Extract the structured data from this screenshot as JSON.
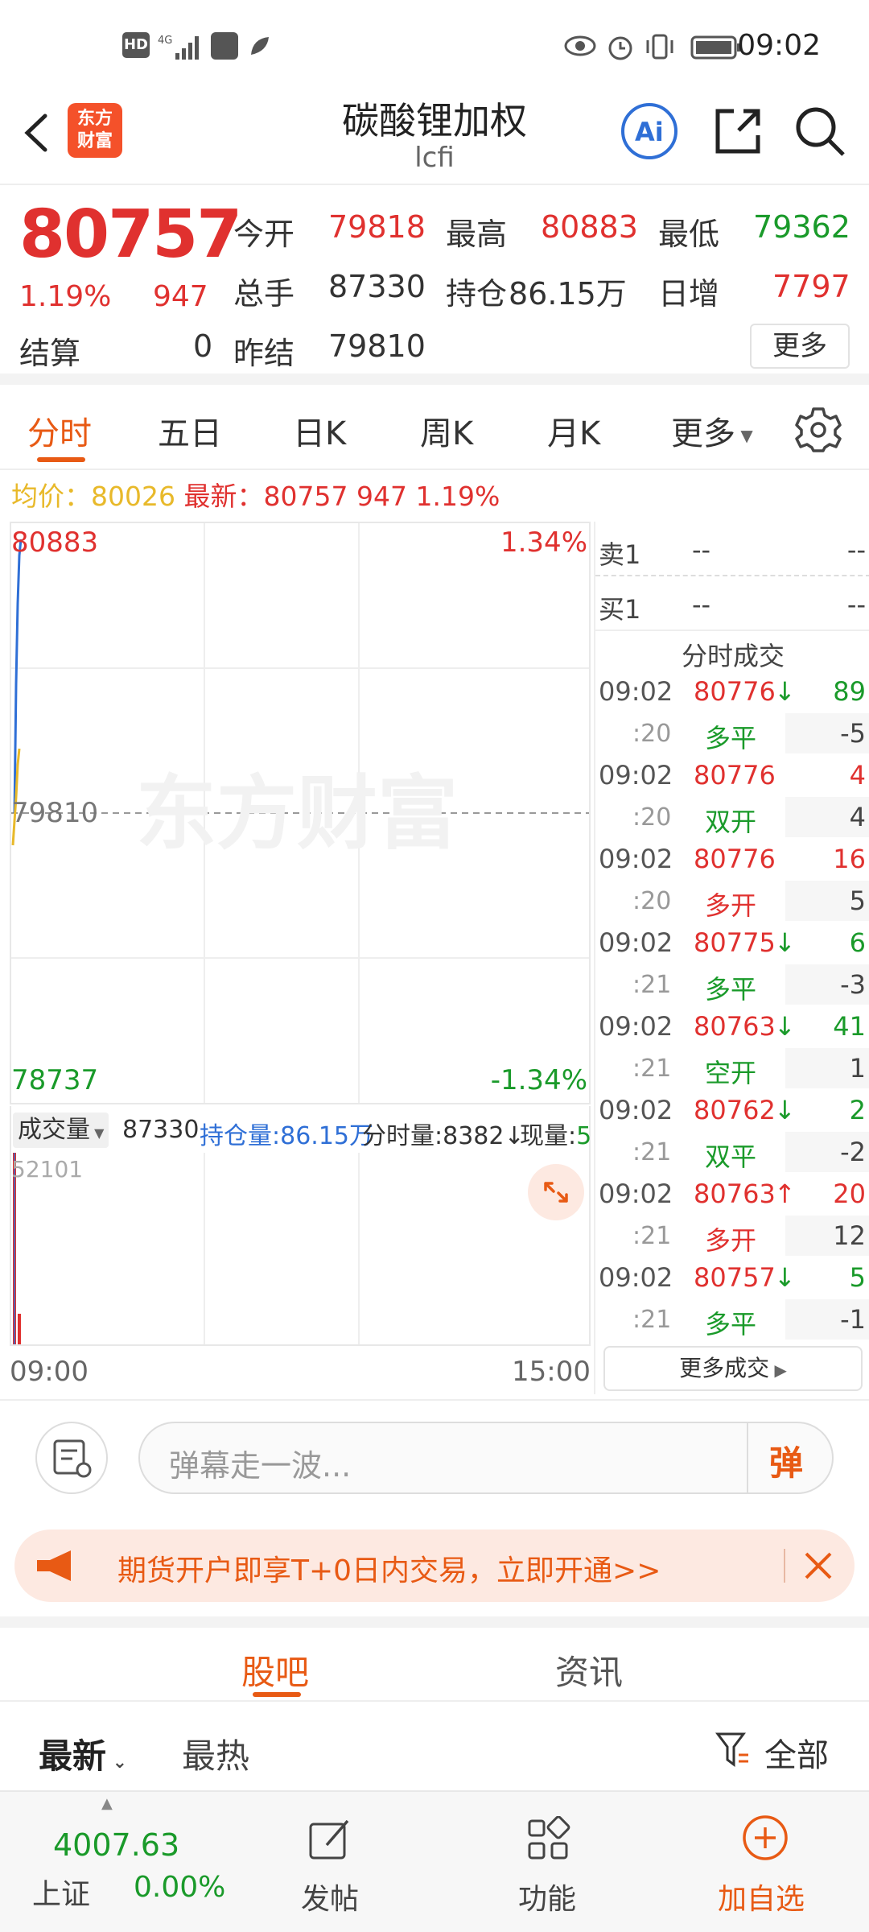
{
  "status_bar": {
    "time": "09:02",
    "left_icons": [
      "hd-icon",
      "signal-4g-icon",
      "bag-icon",
      "leaf-icon"
    ],
    "right_icons": [
      "eye-icon",
      "alarm-icon",
      "vibrate-icon",
      "battery-icon"
    ]
  },
  "header": {
    "title": "碳酸锂加权",
    "subtitle": "lcfi",
    "logo_text_line1": "东方",
    "logo_text_line2": "财富"
  },
  "quote": {
    "last_price": "80757",
    "change_pct": "1.19%",
    "change": "947",
    "open_label": "今开",
    "open": "79818",
    "high_label": "最高",
    "high": "80883",
    "low_label": "最低",
    "low": "79362",
    "volume_label": "总手",
    "volume": "87330",
    "oi_label": "持仓",
    "oi": "86.15万",
    "daily_inc_label": "日增",
    "daily_inc": "7797",
    "settle_label": "结算",
    "settle": "0",
    "prev_settle_label": "昨结",
    "prev_settle": "79810",
    "more_label": "更多"
  },
  "tabs": [
    {
      "label": "分时"
    },
    {
      "label": "五日"
    },
    {
      "label": "日K"
    },
    {
      "label": "周K"
    },
    {
      "label": "月K"
    },
    {
      "label": "更多"
    }
  ],
  "info_line": {
    "avg_label": "均价：",
    "avg": "80026",
    "latest_label": "最新：",
    "latest": "80757",
    "change": "947",
    "pct": "1.19%"
  },
  "chart": {
    "high_price": "80883",
    "high_pct": "1.34%",
    "mid_price": "79810",
    "low_price": "78737",
    "low_pct": "-1.34%",
    "watermark": "东方财富",
    "time_start": "09:00",
    "time_end": "15:00",
    "vol_max": "52101",
    "colors": {
      "price_line": "#2f6fd6",
      "avg_line": "#e8b92a",
      "volume": "#e0312f"
    }
  },
  "chart_data": {
    "type": "line",
    "x": [
      "09:00",
      "09:01",
      "09:02"
    ],
    "series": [],
    "ylim": [
      78737,
      80883
    ]
  },
  "volbar": {
    "dropdown_label": "成交量",
    "volume": "87330",
    "oi_label": "持仓量:86.15万",
    "tick_label": "分时量:8382",
    "arrow": "↓",
    "now_label": "现量:",
    "now": "5"
  },
  "orderbook": {
    "sell1_label": "卖1",
    "sell1_price": "--",
    "sell1_vol": "--",
    "buy1_label": "买1",
    "buy1_price": "--",
    "buy1_vol": "--",
    "trades_title": "分时成交",
    "trades": [
      {
        "time": "09:02",
        "price": "80776",
        "arrow": "↓",
        "vol": "89",
        "sub_time": ":20",
        "type": "多平",
        "type_vol": "-5"
      },
      {
        "time": "09:02",
        "price": "80776",
        "arrow": "",
        "vol": "4",
        "sub_time": ":20",
        "type": "双开",
        "type_vol": "4"
      },
      {
        "time": "09:02",
        "price": "80776",
        "arrow": "",
        "vol": "16",
        "sub_time": ":20",
        "type": "多开",
        "type_vol": "5"
      },
      {
        "time": "09:02",
        "price": "80775",
        "arrow": "↓",
        "vol": "6",
        "sub_time": ":21",
        "type": "多平",
        "type_vol": "-3"
      },
      {
        "time": "09:02",
        "price": "80763",
        "arrow": "↓",
        "vol": "41",
        "sub_time": ":21",
        "type": "空开",
        "type_vol": "1"
      },
      {
        "time": "09:02",
        "price": "80762",
        "arrow": "↓",
        "vol": "2",
        "sub_time": ":21",
        "type": "双平",
        "type_vol": "-2"
      },
      {
        "time": "09:02",
        "price": "80763",
        "arrow": "↑",
        "vol": "20",
        "sub_time": ":21",
        "type": "多开",
        "type_vol": "12"
      },
      {
        "time": "09:02",
        "price": "80757",
        "arrow": "↓",
        "vol": "5",
        "sub_time": ":21",
        "type": "多平",
        "type_vol": "-1"
      }
    ],
    "more_trades_label": "更多成交"
  },
  "danmaku": {
    "placeholder": "弹幕走一波...",
    "send_label": "弹"
  },
  "promo": {
    "text": "期货开户即享T+0日内交易，立即开通>>"
  },
  "section_tabs": [
    {
      "label": "股吧"
    },
    {
      "label": "资讯"
    }
  ],
  "filters": {
    "latest": "最新",
    "hot": "最热",
    "all": "全部"
  },
  "bottom_bar": {
    "index_value": "4007.63",
    "index_name": "上证",
    "index_change": "0.00%",
    "post_label": "发帖",
    "func_label": "功能",
    "add_label": "加自选"
  }
}
